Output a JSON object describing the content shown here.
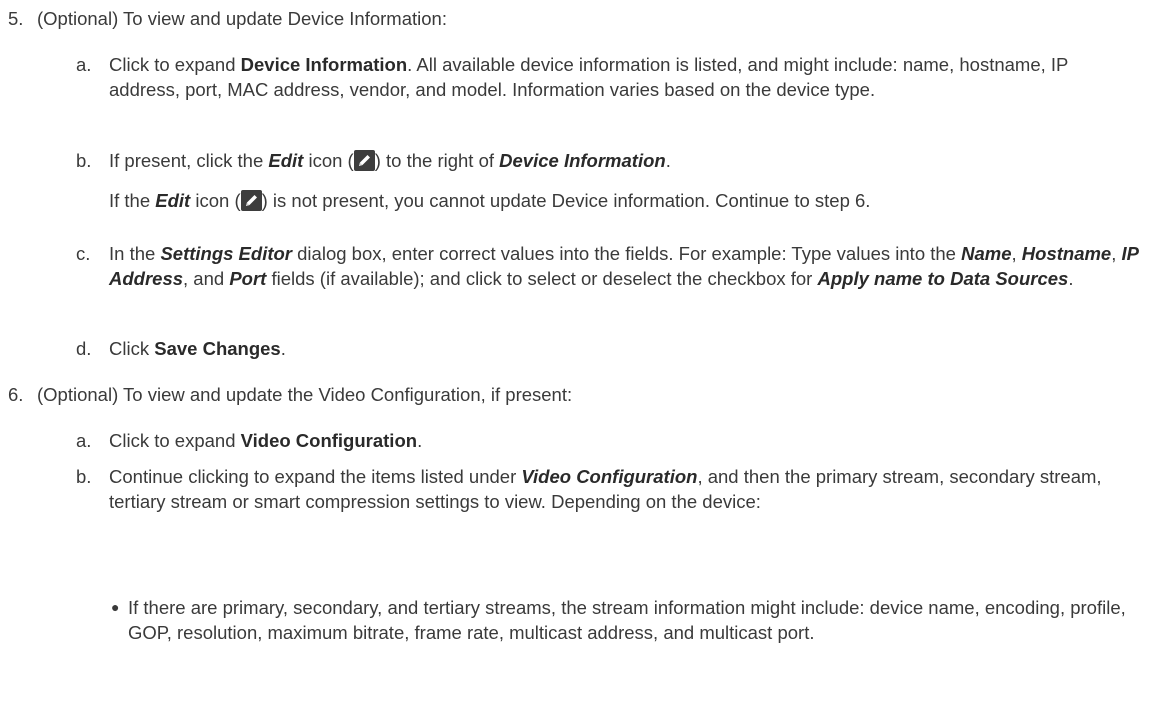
{
  "steps": [
    {
      "number": "5.",
      "intro": "(Optional) To view and update Device Information:",
      "substeps": [
        {
          "letter": "a.",
          "t1": "Click to expand ",
          "b1": "Device Information",
          "t2": ". All available device information is listed, and might include: name, hostname, IP address, port, MAC address, vendor, and model. Information varies based on the device type."
        },
        {
          "letter": "b.",
          "t1": "If present, click the ",
          "i1": "Edit",
          "t2": " icon (",
          "t3": ") to the right of ",
          "i2": "Device Information",
          "t4": ".",
          "note": {
            "t1": "If the ",
            "i1": "Edit",
            "t2": " icon (",
            "t3": ") is not present, you cannot update Device information. Continue to step 6."
          }
        },
        {
          "letter": "c.",
          "t1": "In the ",
          "i1": "Settings Editor",
          "t2": " dialog box, enter correct values into the fields. For example: Type values into the ",
          "i2": "Name",
          "t3": ", ",
          "i3": "Hostname",
          "t4": ", ",
          "i4": "IP Address",
          "t5": ", and ",
          "i5": "Port",
          "t6": " fields (if available); and click to select or deselect the checkbox for ",
          "i6": "Apply name to Data Sources",
          "t7": "."
        },
        {
          "letter": "d.",
          "t1": "Click ",
          "b1": "Save Changes",
          "t2": "."
        }
      ]
    },
    {
      "number": "6.",
      "intro": "(Optional) To view and update the Video Configuration, if present:",
      "substeps": [
        {
          "letter": "a.",
          "t1": "Click to expand ",
          "b1": "Video Configuration",
          "t2": "."
        },
        {
          "letter": "b.",
          "t1": "Continue clicking to expand the items listed under ",
          "i1": "Video Configuration",
          "t2": ", and then the primary stream, secondary stream, tertiary stream or smart compression settings to view. Depending on the device:",
          "bullets": [
            {
              "text": "If there are primary, secondary, and tertiary streams, the stream information might include: device name, encoding, profile, GOP, resolution, maximum bitrate, frame rate, multicast address, and multicast port."
            }
          ]
        }
      ]
    }
  ],
  "icons": {
    "edit": "edit-pencil-icon"
  },
  "colors": {
    "text": "#3a3a3a",
    "icon_bg": "#3d3d3d"
  }
}
